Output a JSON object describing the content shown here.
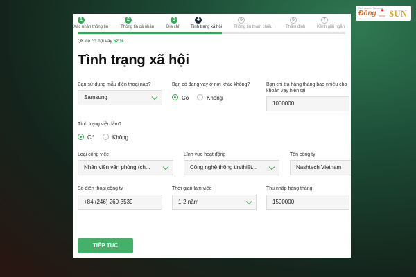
{
  "steps": [
    {
      "num": "1",
      "label": "Xác nhận thông tin",
      "state": "done"
    },
    {
      "num": "2",
      "label": "Thông tin cá nhân",
      "state": "done"
    },
    {
      "num": "3",
      "label": "Địa chỉ",
      "state": "done"
    },
    {
      "num": "4",
      "label": "Tình trạng xã hội",
      "state": "active"
    },
    {
      "num": "5",
      "label": "Thông tin tham chiếu",
      "state": "todo"
    },
    {
      "num": "6",
      "label": "Thẩm định",
      "state": "todo"
    },
    {
      "num": "7",
      "label": "Kênh giải ngân",
      "state": "todo"
    }
  ],
  "progress": 0.54,
  "probability": {
    "label": "QK có cơ hội vay",
    "value": "52 %"
  },
  "title": "Tình trạng xã hội",
  "form": {
    "phone_model": {
      "label": "Bạn sử dụng mẫu điện thoại nào?",
      "value": "Samsung"
    },
    "other_loan": {
      "label": "Bạn có đang vay ở nơi khác không?",
      "yes": "Có",
      "no": "Không",
      "selected": "yes"
    },
    "monthly_payment": {
      "label": "Bạn chi trả hàng tháng bao nhiêu cho khoản vay hiện tại",
      "value": "1000000"
    },
    "employment": {
      "label": "Tình trạng việc làm?",
      "yes": "Có",
      "no": "Không",
      "selected": "yes"
    },
    "job_type": {
      "label": "Loại công việc",
      "value": "Nhân viên văn phòng (ch..."
    },
    "industry": {
      "label": "Lĩnh vực hoạt động",
      "value": "Công nghệ thông tin/thiết..."
    },
    "company": {
      "label": "Tên công ty",
      "value": "Nashtech Vietnam"
    },
    "company_phone": {
      "label": "Số điện thoại công ty",
      "value": "+84 (246) 260-3539"
    },
    "work_duration": {
      "label": "Thời gian làm việc",
      "value": "1-2 năm"
    },
    "income": {
      "label": "Thu nhập hàng tháng",
      "value": "1500000"
    }
  },
  "continue_label": "TIẾP TỤC",
  "logo": {
    "small": "Kinh doanh / Tài chính",
    "dong": "Đồng",
    "shop": "shop",
    "sun": "SUN"
  },
  "colors": {
    "accent": "#3aa55a",
    "button": "#45b06a"
  }
}
